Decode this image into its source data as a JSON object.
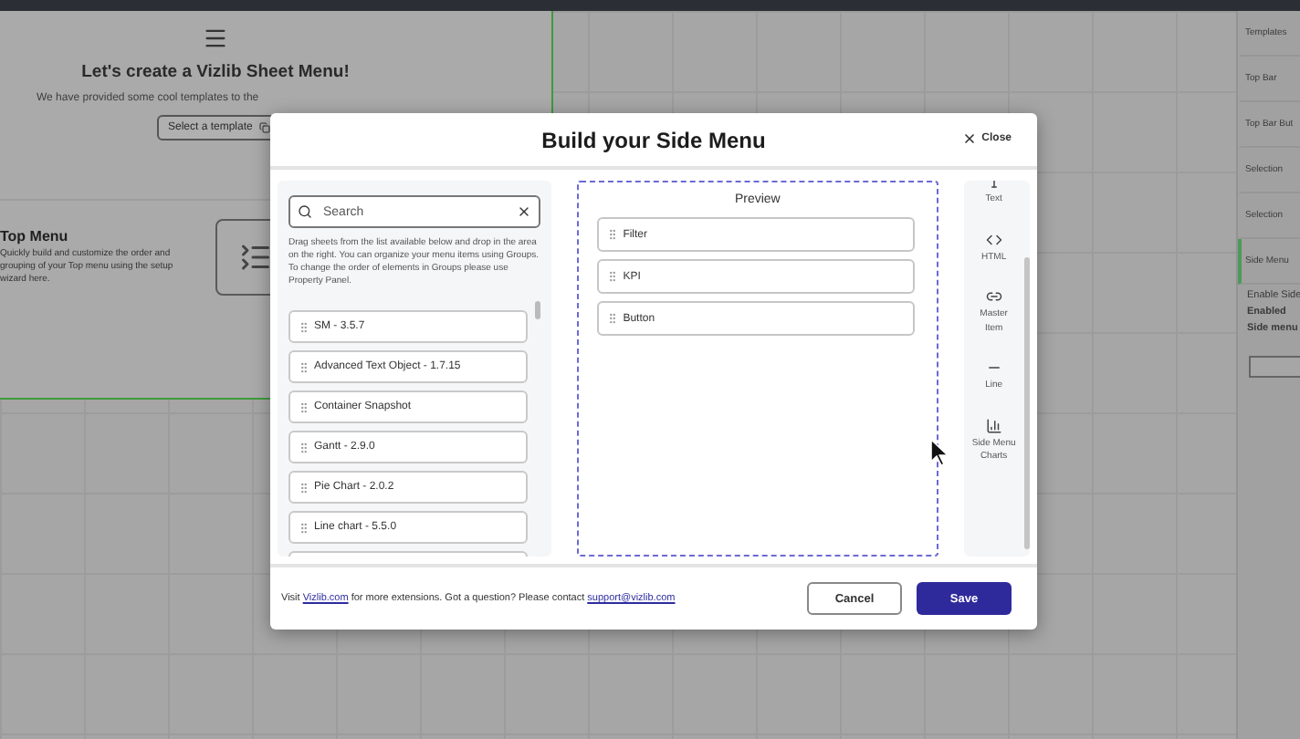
{
  "background": {
    "menu_title": "Let's create a Vizlib Sheet Menu!",
    "intro": "We have provided some cool templates to the",
    "template_button": "Select a template",
    "top_menu": {
      "title": "Top Menu",
      "description": "Quickly build and customize the order and grouping of your Top menu using the setup wizard here."
    }
  },
  "side_panel": {
    "items": [
      {
        "label": "Templates",
        "selected": false
      },
      {
        "label": "Top Bar",
        "selected": false
      },
      {
        "label": "Top Bar But",
        "selected": false
      },
      {
        "label": "Selection",
        "selected": false
      },
      {
        "label": "Selection",
        "selected": false
      },
      {
        "label": "Side Menu",
        "selected": true
      }
    ],
    "setting_label": "Enable Side",
    "setting_value": "Enabled",
    "section_label": "Side menu"
  },
  "modal": {
    "title": "Build your Side Menu",
    "close": "Close",
    "search": {
      "placeholder": "Search"
    },
    "hint": "Drag sheets from the list available below and drop in the area on the right. You can organize your menu items using Groups. To change the order of elements in Groups please use Property Panel.",
    "sheets": [
      "SM - 3.5.7",
      "Advanced Text Object - 1.7.15",
      "Container Snapshot",
      "Gantt - 2.9.0",
      "Pie Chart - 2.0.2",
      "Line chart - 5.5.0"
    ],
    "preview": {
      "title": "Preview",
      "items": [
        "Filter",
        "KPI",
        "Button"
      ]
    },
    "elements": [
      {
        "kind": "text",
        "label": "Text"
      },
      {
        "kind": "html",
        "label": "HTML"
      },
      {
        "kind": "master",
        "label": "Master Item"
      },
      {
        "kind": "line",
        "label": "Line"
      },
      {
        "kind": "charts",
        "label": "Side Menu Charts"
      }
    ],
    "footer": {
      "text_before": "Visit",
      "link": "Vizlib.com",
      "text_middle": "for more extensions. Got a question? Please contact",
      "email": "support@vizlib.com"
    },
    "cancel": "Cancel",
    "save": "Save"
  }
}
